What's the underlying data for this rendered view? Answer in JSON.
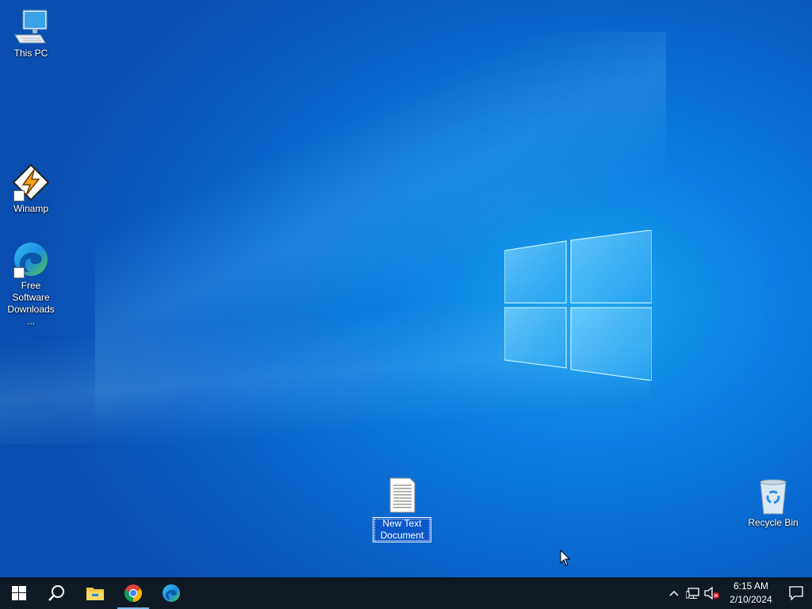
{
  "desktop": {
    "icons": [
      {
        "label": "This PC"
      },
      {
        "label": "Winamp"
      },
      {
        "label": "Free Software Downloads ..."
      },
      {
        "label": "New Text Document"
      },
      {
        "label": "Recycle Bin"
      }
    ]
  },
  "taskbar": {
    "apps": [
      "start-icon",
      "search-icon",
      "file-explorer-icon",
      "chrome-icon",
      "edge-icon"
    ],
    "clock": {
      "time": "6:15 AM",
      "date": "2/10/2024"
    }
  },
  "colors": {
    "taskbar": "#101a24",
    "accent": "#76b9ed",
    "wallpaper": "#0a7ee0"
  }
}
